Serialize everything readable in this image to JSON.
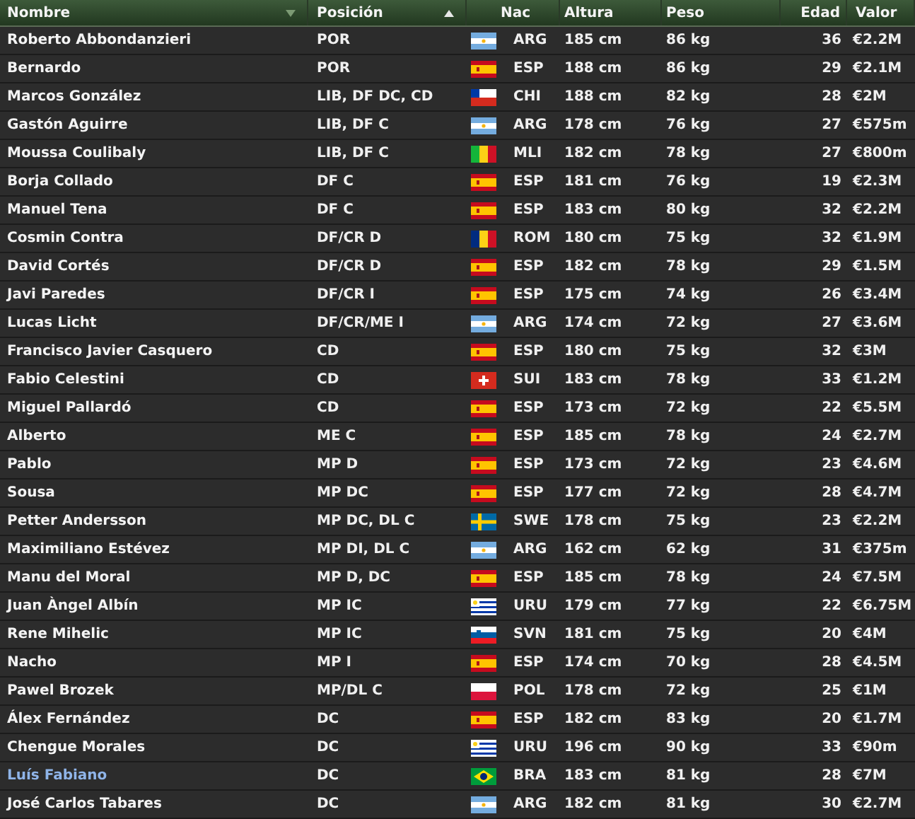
{
  "columns": [
    {
      "label": "Nombre",
      "kind": "descending"
    },
    {
      "label": "Posición",
      "kind": "ascending"
    },
    {
      "label": "Nac",
      "kind": "plain"
    },
    {
      "label": "Altura",
      "kind": "plain"
    },
    {
      "label": "Peso",
      "kind": "plain"
    },
    {
      "label": "Edad",
      "kind": "plain"
    },
    {
      "label": "Valor",
      "kind": "plain"
    }
  ],
  "rows": [
    {
      "name": "Roberto Abbondanzieri",
      "position": "POR",
      "kind": "ar",
      "nation": "ARG",
      "height": "185 cm",
      "weight": "86 kg",
      "age": "36",
      "value": "€2.2M",
      "highlighted": false
    },
    {
      "name": "Bernardo",
      "position": "POR",
      "kind": "es",
      "nation": "ESP",
      "height": "188 cm",
      "weight": "86 kg",
      "age": "29",
      "value": "€2.1M",
      "highlighted": false
    },
    {
      "name": "Marcos González",
      "position": "LIB, DF DC, CD",
      "kind": "cl",
      "nation": "CHI",
      "height": "188 cm",
      "weight": "82 kg",
      "age": "28",
      "value": "€2M",
      "highlighted": false
    },
    {
      "name": "Gastón Aguirre",
      "position": "LIB, DF C",
      "kind": "ar",
      "nation": "ARG",
      "height": "178 cm",
      "weight": "76 kg",
      "age": "27",
      "value": "€575m",
      "highlighted": false
    },
    {
      "name": "Moussa Coulibaly",
      "position": "LIB, DF C",
      "kind": "ml",
      "nation": "MLI",
      "height": "182 cm",
      "weight": "78 kg",
      "age": "27",
      "value": "€800m",
      "highlighted": false
    },
    {
      "name": "Borja Collado",
      "position": "DF C",
      "kind": "es",
      "nation": "ESP",
      "height": "181 cm",
      "weight": "76 kg",
      "age": "19",
      "value": "€2.3M",
      "highlighted": false
    },
    {
      "name": "Manuel Tena",
      "position": "DF C",
      "kind": "es",
      "nation": "ESP",
      "height": "183 cm",
      "weight": "80 kg",
      "age": "32",
      "value": "€2.2M",
      "highlighted": false
    },
    {
      "name": "Cosmin Contra",
      "position": "DF/CR D",
      "kind": "ro",
      "nation": "ROM",
      "height": "180 cm",
      "weight": "75 kg",
      "age": "32",
      "value": "€1.9M",
      "highlighted": false
    },
    {
      "name": "David Cortés",
      "position": "DF/CR D",
      "kind": "es",
      "nation": "ESP",
      "height": "182 cm",
      "weight": "78 kg",
      "age": "29",
      "value": "€1.5M",
      "highlighted": false
    },
    {
      "name": "Javi Paredes",
      "position": "DF/CR I",
      "kind": "es",
      "nation": "ESP",
      "height": "175 cm",
      "weight": "74 kg",
      "age": "26",
      "value": "€3.4M",
      "highlighted": false
    },
    {
      "name": "Lucas Licht",
      "position": "DF/CR/ME I",
      "kind": "ar",
      "nation": "ARG",
      "height": "174 cm",
      "weight": "72 kg",
      "age": "27",
      "value": "€3.6M",
      "highlighted": false
    },
    {
      "name": "Francisco Javier Casquero",
      "position": "CD",
      "kind": "es",
      "nation": "ESP",
      "height": "180 cm",
      "weight": "75 kg",
      "age": "32",
      "value": "€3M",
      "highlighted": false
    },
    {
      "name": "Fabio Celestini",
      "position": "CD",
      "kind": "ch",
      "nation": "SUI",
      "height": "183 cm",
      "weight": "78 kg",
      "age": "33",
      "value": "€1.2M",
      "highlighted": false
    },
    {
      "name": "Miguel Pallardó",
      "position": "CD",
      "kind": "es",
      "nation": "ESP",
      "height": "173 cm",
      "weight": "72 kg",
      "age": "22",
      "value": "€5.5M",
      "highlighted": false
    },
    {
      "name": "Alberto",
      "position": "ME C",
      "kind": "es",
      "nation": "ESP",
      "height": "185 cm",
      "weight": "78 kg",
      "age": "24",
      "value": "€2.7M",
      "highlighted": false
    },
    {
      "name": "Pablo",
      "position": "MP D",
      "kind": "es",
      "nation": "ESP",
      "height": "173 cm",
      "weight": "72 kg",
      "age": "23",
      "value": "€4.6M",
      "highlighted": false
    },
    {
      "name": "Sousa",
      "position": "MP DC",
      "kind": "es",
      "nation": "ESP",
      "height": "177 cm",
      "weight": "72 kg",
      "age": "28",
      "value": "€4.7M",
      "highlighted": false
    },
    {
      "name": "Petter Andersson",
      "position": "MP DC, DL C",
      "kind": "se",
      "nation": "SWE",
      "height": "178 cm",
      "weight": "75 kg",
      "age": "23",
      "value": "€2.2M",
      "highlighted": false
    },
    {
      "name": "Maximiliano Estévez",
      "position": "MP DI, DL C",
      "kind": "ar",
      "nation": "ARG",
      "height": "162 cm",
      "weight": "62 kg",
      "age": "31",
      "value": "€375m",
      "highlighted": false
    },
    {
      "name": "Manu del Moral",
      "position": "MP D, DC",
      "kind": "es",
      "nation": "ESP",
      "height": "185 cm",
      "weight": "78 kg",
      "age": "24",
      "value": "€7.5M",
      "highlighted": false
    },
    {
      "name": "Juan Àngel Albín",
      "position": "MP IC",
      "kind": "uy",
      "nation": "URU",
      "height": "179 cm",
      "weight": "77 kg",
      "age": "22",
      "value": "€6.75M",
      "highlighted": false
    },
    {
      "name": "Rene Mihelic",
      "position": "MP IC",
      "kind": "si",
      "nation": "SVN",
      "height": "181 cm",
      "weight": "75 kg",
      "age": "20",
      "value": "€4M",
      "highlighted": false
    },
    {
      "name": "Nacho",
      "position": "MP I",
      "kind": "es",
      "nation": "ESP",
      "height": "174 cm",
      "weight": "70 kg",
      "age": "28",
      "value": "€4.5M",
      "highlighted": false
    },
    {
      "name": "Pawel Brozek",
      "position": "MP/DL C",
      "kind": "pl",
      "nation": "POL",
      "height": "178 cm",
      "weight": "72 kg",
      "age": "25",
      "value": "€1M",
      "highlighted": false
    },
    {
      "name": "Álex Fernández",
      "position": "DC",
      "kind": "es",
      "nation": "ESP",
      "height": "182 cm",
      "weight": "83 kg",
      "age": "20",
      "value": "€1.7M",
      "highlighted": false
    },
    {
      "name": "Chengue Morales",
      "position": "DC",
      "kind": "uy",
      "nation": "URU",
      "height": "196 cm",
      "weight": "90 kg",
      "age": "33",
      "value": "€90m",
      "highlighted": false
    },
    {
      "name": "Luís Fabiano",
      "position": "DC",
      "kind": "br",
      "nation": "BRA",
      "height": "183 cm",
      "weight": "81 kg",
      "age": "28",
      "value": "€7M",
      "highlighted": true
    },
    {
      "name": "José Carlos Tabares",
      "position": "DC",
      "kind": "ar",
      "nation": "ARG",
      "height": "182 cm",
      "weight": "81 kg",
      "age": "30",
      "value": "€2.7M",
      "highlighted": false
    }
  ]
}
